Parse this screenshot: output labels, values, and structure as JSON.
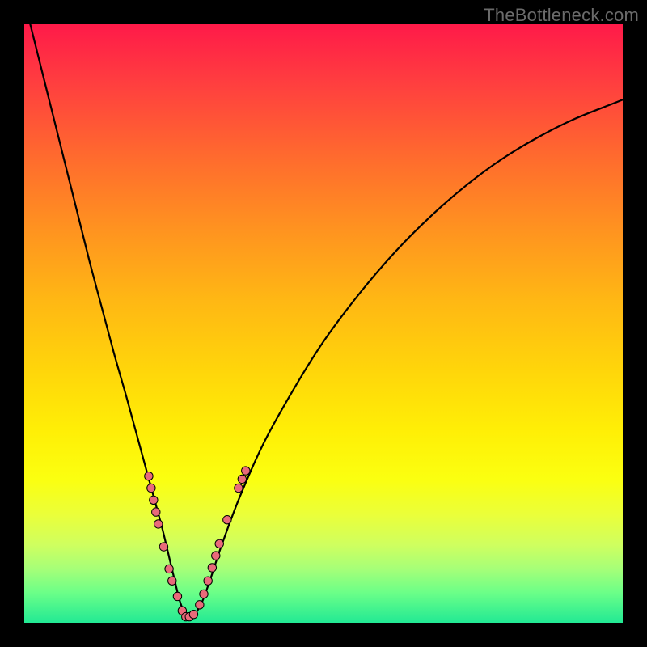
{
  "watermark": "TheBottleneck.com",
  "colors": {
    "frame": "#000000",
    "curve_stroke": "#000000",
    "marker_fill": "#e96a7a",
    "marker_stroke": "#000000"
  },
  "chart_data": {
    "type": "line",
    "title": "",
    "xlabel": "",
    "ylabel": "",
    "xlim": [
      0,
      100
    ],
    "ylim": [
      0,
      100
    ],
    "grid": false,
    "legend": false,
    "series": [
      {
        "name": "curve",
        "x": [
          1,
          3,
          5,
          7,
          9,
          11,
          13,
          15,
          17,
          18.5,
          20,
          21.5,
          23,
          24.2,
          25.2,
          26,
          27,
          28,
          29.5,
          31,
          33,
          36,
          40,
          45,
          50,
          56,
          62,
          68,
          74,
          80,
          86,
          92,
          98,
          100
        ],
        "y": [
          100,
          92,
          84,
          76,
          68,
          60,
          52.5,
          45,
          38,
          32.5,
          27,
          21.5,
          16,
          11,
          6.8,
          3.6,
          1.2,
          1.0,
          3.0,
          7.0,
          13,
          21,
          30,
          39,
          47,
          55,
          62,
          68,
          73.2,
          77.6,
          81.2,
          84.2,
          86.6,
          87.4
        ]
      }
    ],
    "markers": [
      {
        "x": 20.8,
        "y": 24.5
      },
      {
        "x": 21.2,
        "y": 22.5
      },
      {
        "x": 21.6,
        "y": 20.5
      },
      {
        "x": 22.0,
        "y": 18.5
      },
      {
        "x": 22.4,
        "y": 16.5
      },
      {
        "x": 23.3,
        "y": 12.7
      },
      {
        "x": 24.2,
        "y": 9.0
      },
      {
        "x": 24.7,
        "y": 7.0
      },
      {
        "x": 25.6,
        "y": 4.4
      },
      {
        "x": 26.4,
        "y": 2.0
      },
      {
        "x": 27.0,
        "y": 1.0
      },
      {
        "x": 27.6,
        "y": 1.0
      },
      {
        "x": 28.3,
        "y": 1.4
      },
      {
        "x": 29.3,
        "y": 3.0
      },
      {
        "x": 30.0,
        "y": 4.8
      },
      {
        "x": 30.7,
        "y": 7.0
      },
      {
        "x": 31.4,
        "y": 9.2
      },
      {
        "x": 32.0,
        "y": 11.2
      },
      {
        "x": 32.6,
        "y": 13.2
      },
      {
        "x": 33.9,
        "y": 17.2
      },
      {
        "x": 35.8,
        "y": 22.5
      },
      {
        "x": 36.4,
        "y": 24.0
      },
      {
        "x": 37.0,
        "y": 25.4
      }
    ],
    "marker_radius_px": 5.2
  }
}
